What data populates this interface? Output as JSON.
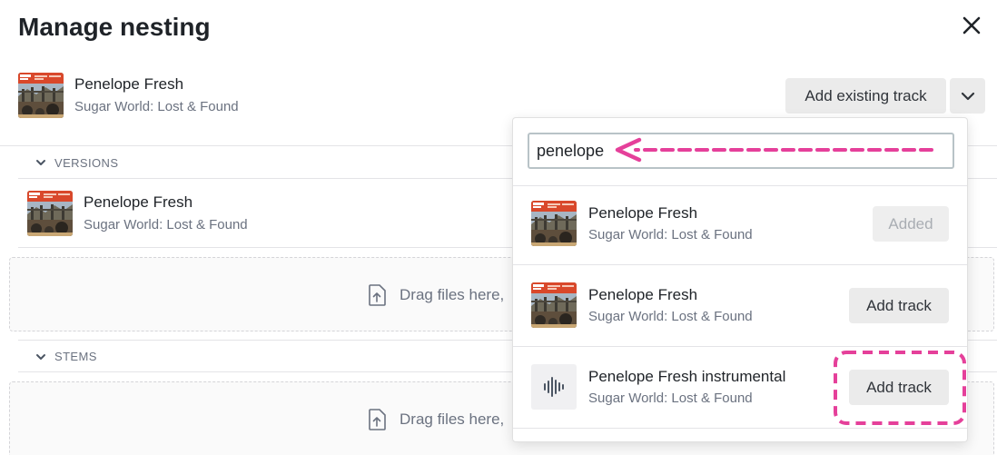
{
  "header": {
    "title": "Manage nesting"
  },
  "current_track": {
    "title": "Penelope Fresh",
    "album": "Sugar World: Lost & Found"
  },
  "add_existing": {
    "label": "Add existing track"
  },
  "versions": {
    "label": "VERSIONS",
    "track": {
      "title": "Penelope Fresh",
      "album": "Sugar World: Lost & Found"
    },
    "dropzone_text": "Drag files here,"
  },
  "stems": {
    "label": "STEMS",
    "dropzone_text": "Drag files here,"
  },
  "dropdown": {
    "search_value": "penelope",
    "results": [
      {
        "title": "Penelope Fresh",
        "album": "Sugar World: Lost & Found",
        "button": "Added",
        "icon": "album-art"
      },
      {
        "title": "Penelope Fresh",
        "album": "Sugar World: Lost & Found",
        "button": "Add track",
        "icon": "album-art"
      },
      {
        "title": "Penelope Fresh instrumental",
        "album": "Sugar World: Lost & Found",
        "button": "Add track",
        "icon": "waveform-icon"
      }
    ]
  },
  "colors": {
    "annotation": "#e5409a",
    "button_bg": "#ebebeb",
    "muted_text": "#6b7280"
  }
}
